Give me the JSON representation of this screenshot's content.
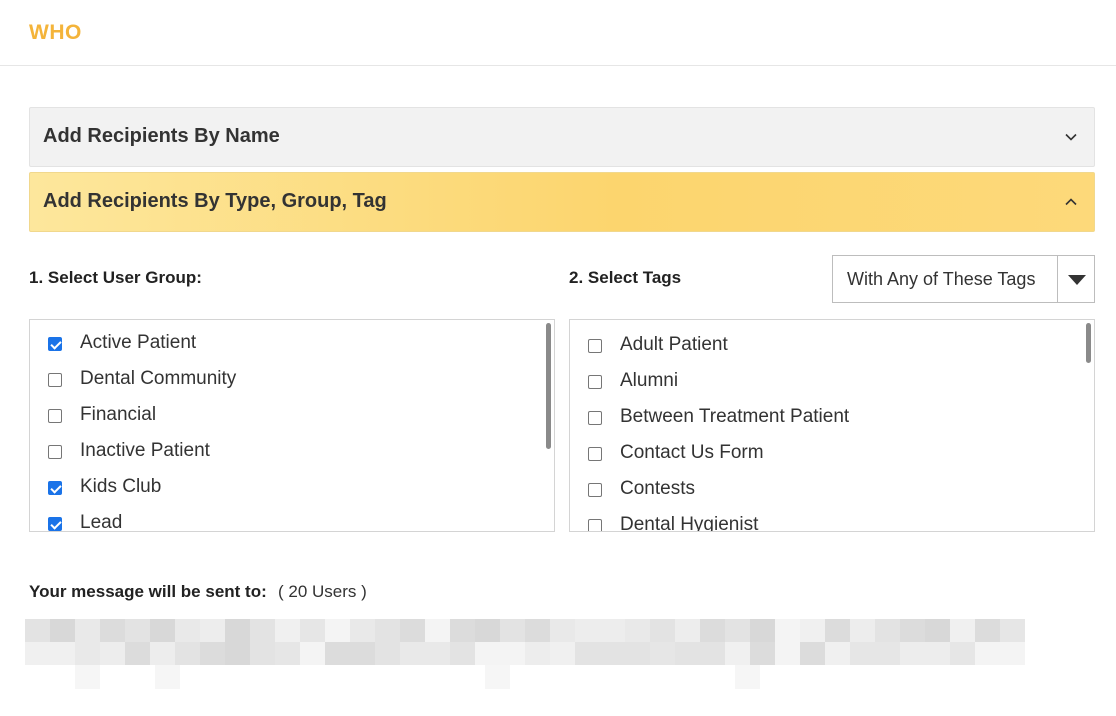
{
  "section": {
    "title": "WHO"
  },
  "accordions": [
    {
      "label": "Add Recipients By Name",
      "state": "collapsed"
    },
    {
      "label": "Add Recipients By Type, Group, Tag",
      "state": "expanded"
    }
  ],
  "user_group": {
    "label": "1. Select User Group:",
    "items": [
      {
        "label": "Active Patient",
        "checked": true
      },
      {
        "label": "Dental Community",
        "checked": false
      },
      {
        "label": "Financial",
        "checked": false
      },
      {
        "label": "Inactive Patient",
        "checked": false
      },
      {
        "label": "Kids Club",
        "checked": true
      },
      {
        "label": "Lead",
        "checked": true
      }
    ]
  },
  "tags": {
    "label": "2. Select Tags",
    "match_mode": "With Any of These Tags",
    "items": [
      {
        "label": "Adult Patient",
        "checked": false
      },
      {
        "label": "Alumni",
        "checked": false
      },
      {
        "label": "Between Treatment Patient",
        "checked": false
      },
      {
        "label": "Contact Us Form",
        "checked": false
      },
      {
        "label": "Contests",
        "checked": false
      },
      {
        "label": "Dental Hygienist",
        "checked": false
      }
    ]
  },
  "summary": {
    "label": "Your message will be sent to:",
    "count": "( 20 Users )"
  },
  "colors": {
    "accent": "#f4b43a",
    "expanded_header": "#fcd56e",
    "checkbox_checked": "#1a73e8"
  }
}
